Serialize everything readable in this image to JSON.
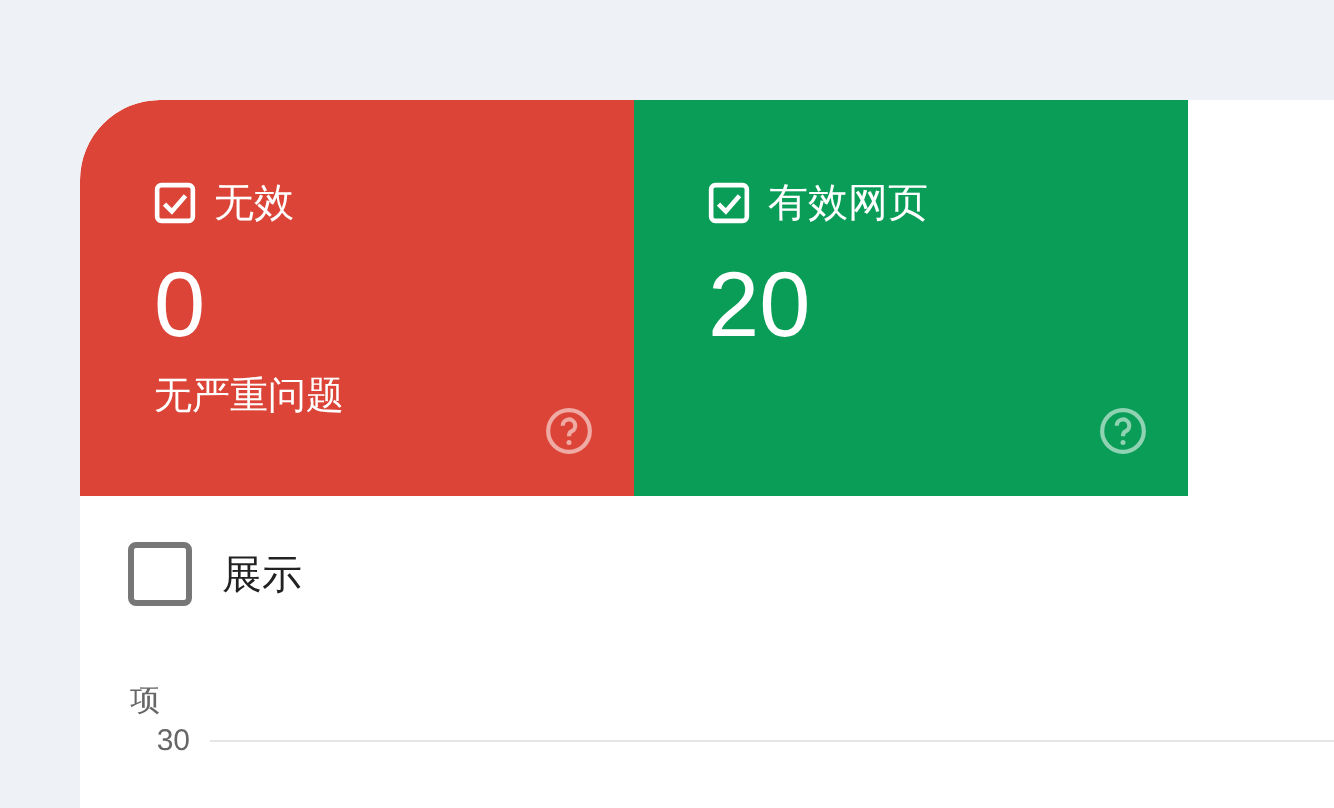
{
  "tiles": [
    {
      "label": "无效",
      "checked": true,
      "color": "#db4437",
      "count": "0",
      "subtitle": "无严重问题"
    },
    {
      "label": "有效网页",
      "checked": true,
      "color": "#0a9d58",
      "count": "20"
    }
  ],
  "show_toggle": {
    "label": "展示",
    "checked": false
  },
  "chart": {
    "y_axis_label": "项",
    "y_ticks": [
      "30"
    ]
  }
}
